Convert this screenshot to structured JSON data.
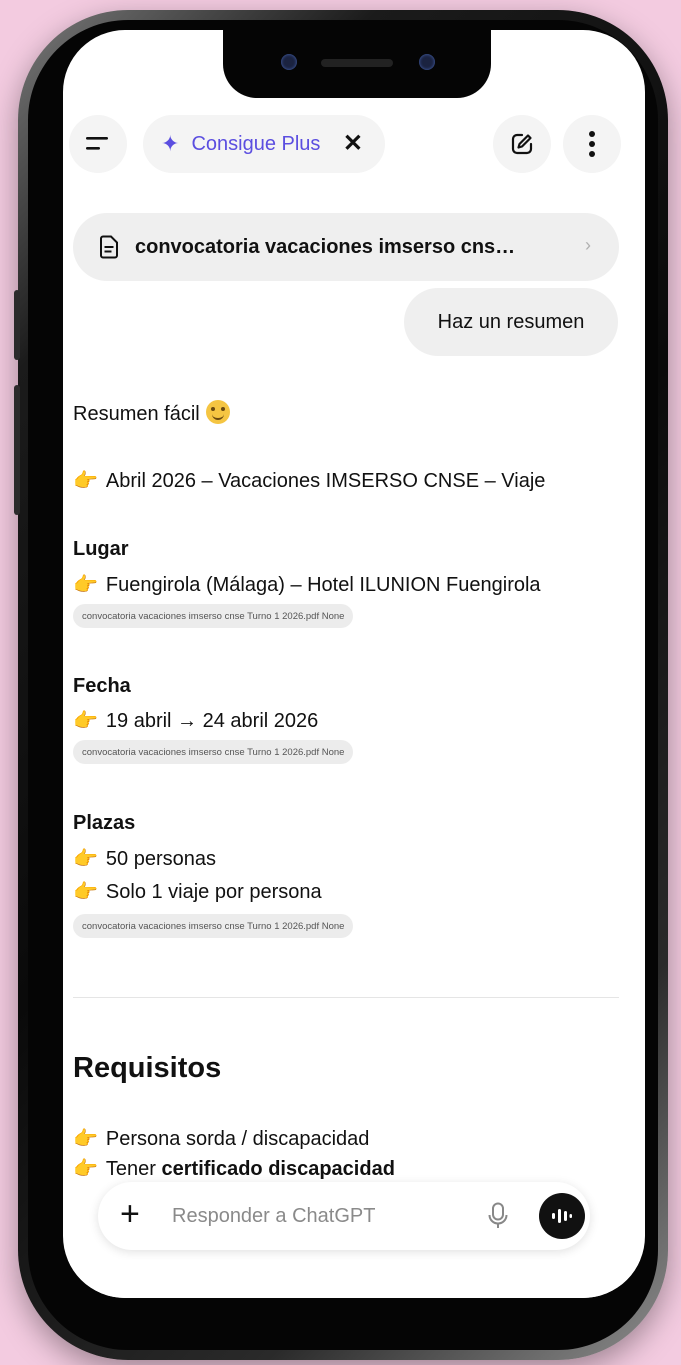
{
  "header": {
    "plus_label": "Consigue Plus",
    "plus_close": "✕"
  },
  "attachment": {
    "name": "convocatoria vacaciones imserso cns…",
    "chevron": "›"
  },
  "user_message": "Haz un resumen",
  "response": {
    "intro": "Resumen fácil",
    "line1": "Abril 2026 – Vacaciones IMSERSO CNSE – Viaje",
    "lugar_heading": "Lugar",
    "lugar_value": "Fuengirola (Málaga) – Hotel ILUNION Fuengirola",
    "citation": "convocatoria vacaciones imserso cnse Turno 1 2026.pdf None",
    "fecha_heading": "Fecha",
    "fecha_value": "19 abril → 24 abril 2026",
    "plazas_heading": "Plazas",
    "plazas_value1": "50 personas",
    "plazas_value2": "Solo 1 viaje por persona",
    "requisitos_heading": "Requisitos",
    "req1": "Persona sorda / discapacidad",
    "req2_prefix": "Tener ",
    "req2_bold": "certificado discapacidad"
  },
  "composer": {
    "placeholder": "Responder a ChatGPT"
  },
  "icons": {
    "pointer": "👉",
    "spark": "✦",
    "plus": "+"
  },
  "colors": {
    "accent": "#5b4ee0",
    "background": "#f3cbe0"
  }
}
